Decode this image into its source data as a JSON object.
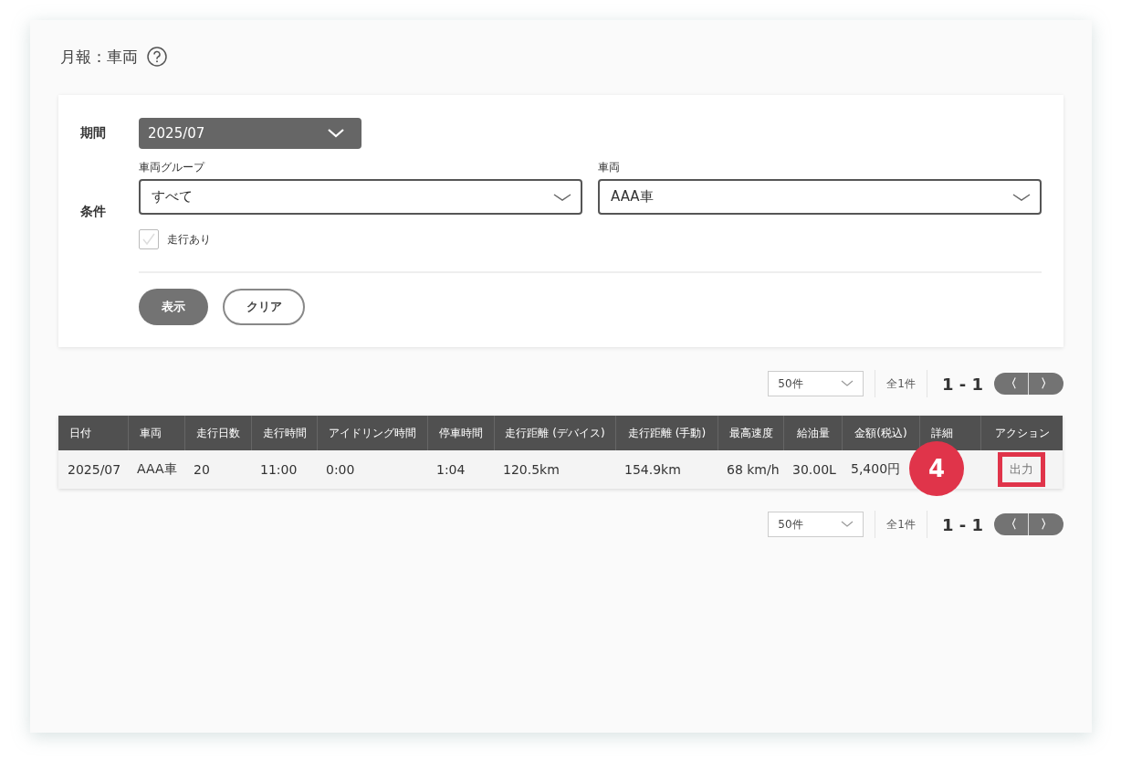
{
  "page_title": "月報：車両",
  "filters": {
    "period": {
      "label": "期間",
      "value": "2025/07"
    },
    "conditions_label": "条件",
    "vehicle_group": {
      "label": "車両グループ",
      "value": "すべて"
    },
    "vehicle": {
      "label": "車両",
      "value": "AAA車"
    },
    "running_only": {
      "label": "走行あり",
      "checked": false
    },
    "buttons": [
      {
        "label": "表示",
        "kind": "primary"
      },
      {
        "label": "クリア",
        "kind": "secondary"
      }
    ]
  },
  "pagers": [
    {
      "per_page": "50件",
      "total": "全1件",
      "range": "1 - 1",
      "prev": "〈",
      "next": "〉"
    },
    {
      "per_page": "50件",
      "total": "全1件",
      "range": "1 - 1",
      "prev": "〈",
      "next": "〉"
    }
  ],
  "table": {
    "columns": [
      "日付",
      "車両",
      "走行日数",
      "走行時間",
      "アイドリング時間",
      "停車時間",
      "走行距離 (デバイス)",
      "走行距離 (手動)",
      "最高速度",
      "給油量",
      "金額(税込)",
      "詳細",
      "アクション"
    ],
    "rows": [
      {
        "cells": [
          "2025/07",
          "AAA車",
          "20",
          "11:00",
          "0:00",
          "1:04",
          "120.5km",
          "154.9km",
          "68 km/h",
          "30.00L",
          "5,400円",
          ""
        ],
        "action": "出力",
        "highlighted": true,
        "step": "4"
      }
    ]
  }
}
